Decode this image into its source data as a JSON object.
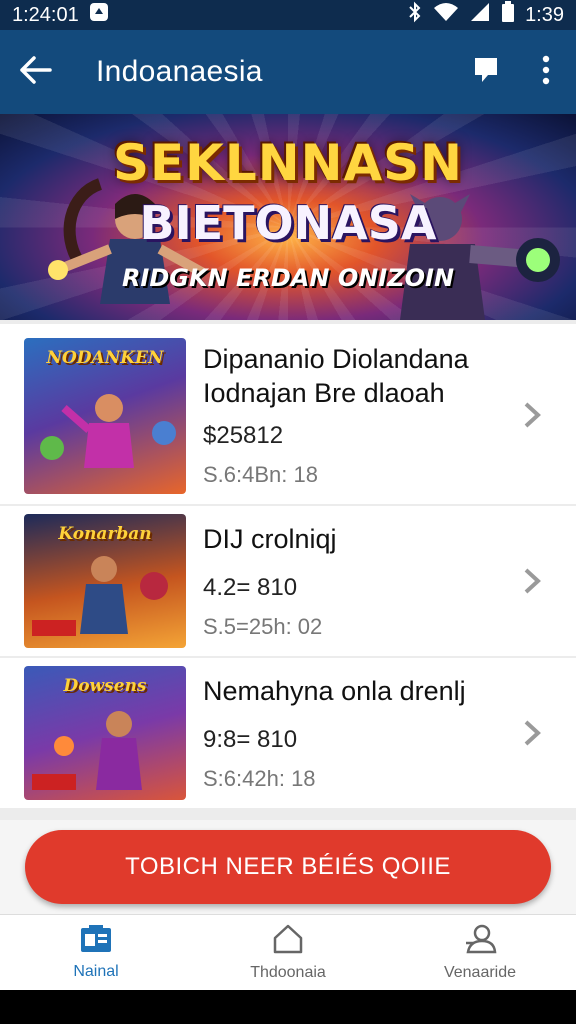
{
  "status_bar": {
    "time_left": "1:24:01",
    "time_right": "1:39"
  },
  "app_bar": {
    "title": "Indoanaesia",
    "back_icon": "arrow-left-icon",
    "actions": [
      "chat-icon",
      "more-vert-icon"
    ]
  },
  "banner": {
    "title_line1": "SEKLNNASN",
    "title_line2": "BIETONASA",
    "subtitle": "RIDGKN ERDAN ONIZOIN"
  },
  "items": [
    {
      "title_line1": "Dipananio Diolandana",
      "title_line2": "Iodnajan Bre dlaoah",
      "price": "$25812",
      "meta": "S.6:4Bn: 18",
      "thumb_label": "NODANKEN"
    },
    {
      "title_line1": "DIJ crolniqj",
      "title_line2": "",
      "price": "4.2= 810",
      "meta": "S.5=25h: 02",
      "thumb_label": "Konarban"
    },
    {
      "title_line1": "Nemahyna onla drenlj",
      "title_line2": "",
      "price": "9:8= 810",
      "meta": "S:6:42h: 18",
      "thumb_label": "Dowsens"
    }
  ],
  "cta": {
    "label": "TOBICH NEER BÉIÉS QOIIE"
  },
  "bottom_nav": [
    {
      "label": "Nainal",
      "icon": "news-icon",
      "active": true
    },
    {
      "label": "Thdoonaia",
      "icon": "home-icon",
      "active": false
    },
    {
      "label": "Venaaride",
      "icon": "profile-icon",
      "active": false
    }
  ],
  "colors": {
    "app_bar": "#134a7c",
    "status_bar": "#0e2c4e",
    "cta": "#e03a2c",
    "nav_active": "#1f73b8"
  }
}
